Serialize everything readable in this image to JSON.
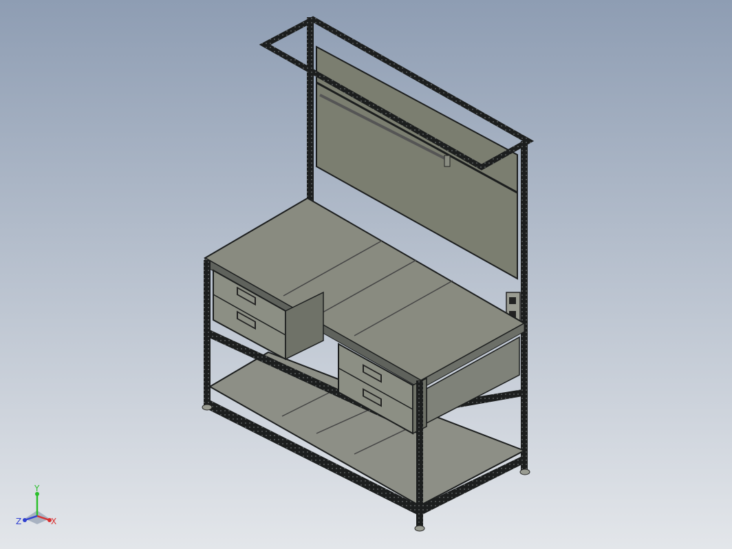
{
  "viewport": {
    "background_top": "#8e9db3",
    "background_bottom": "#e3e6ea"
  },
  "model": {
    "frame_color": "#1c1e1e",
    "panel_color": "#7b7e70",
    "top_color": "#898b80",
    "drawer_color": "#8c8f84",
    "shelf_color": "#8d8f86"
  },
  "triad": {
    "y_label": "Y",
    "x_label": "X",
    "z_label": "Z",
    "y_color": "#2bbf2b",
    "x_color": "#d93030",
    "z_color": "#3040d0"
  }
}
